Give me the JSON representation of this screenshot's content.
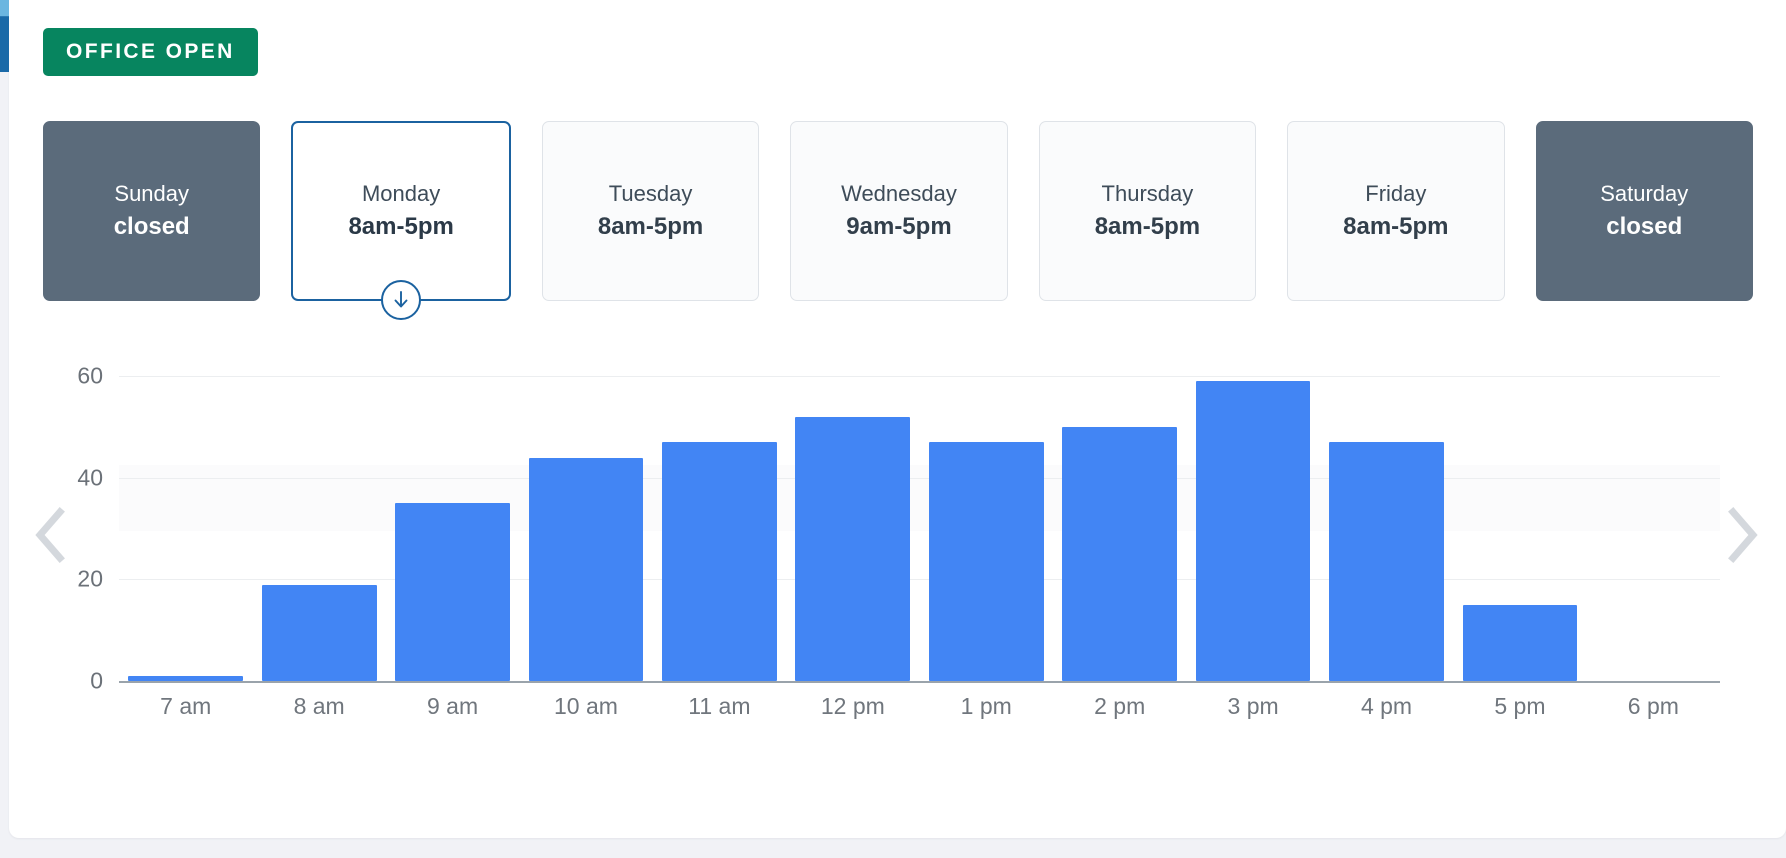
{
  "status_badge": {
    "label": "OFFICE OPEN",
    "color": "#07855f"
  },
  "days": [
    {
      "name": "Sunday",
      "hours": "closed",
      "state": "closed",
      "selected": false
    },
    {
      "name": "Monday",
      "hours": "8am-5pm",
      "state": "open",
      "selected": true
    },
    {
      "name": "Tuesday",
      "hours": "8am-5pm",
      "state": "open",
      "selected": false
    },
    {
      "name": "Wednesday",
      "hours": "9am-5pm",
      "state": "open",
      "selected": false
    },
    {
      "name": "Thursday",
      "hours": "8am-5pm",
      "state": "open",
      "selected": false
    },
    {
      "name": "Friday",
      "hours": "8am-5pm",
      "state": "open",
      "selected": false
    },
    {
      "name": "Saturday",
      "hours": "closed",
      "state": "closed",
      "selected": false
    }
  ],
  "nav": {
    "prev_icon": "chevron-left-icon",
    "next_icon": "chevron-right-icon",
    "pointer_icon": "arrow-down-icon"
  },
  "chart_data": {
    "type": "bar",
    "title": "",
    "xlabel": "",
    "ylabel": "",
    "categories": [
      "7 am",
      "8 am",
      "9 am",
      "10 am",
      "11 am",
      "12 pm",
      "1 pm",
      "2 pm",
      "3 pm",
      "4 pm",
      "5 pm",
      "6 pm"
    ],
    "values": [
      1,
      19,
      35,
      44,
      47,
      52,
      47,
      50,
      59,
      47,
      15,
      0
    ],
    "yticks": [
      0,
      20,
      40,
      60
    ],
    "ylim": [
      0,
      63
    ],
    "grid": true,
    "legend": false,
    "bar_color": "#4285f4"
  }
}
